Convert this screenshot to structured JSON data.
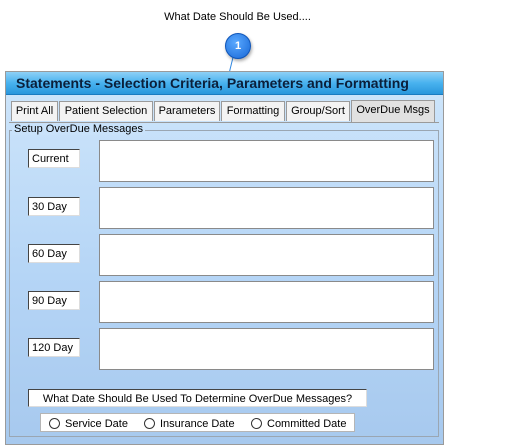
{
  "caption": "What Date Should Be Used....",
  "callout_number": "1",
  "window": {
    "title": "Statements - Selection Criteria, Parameters and Formatting"
  },
  "tabs": [
    {
      "label": "Print All"
    },
    {
      "label": "Patient Selection"
    },
    {
      "label": "Parameters"
    },
    {
      "label": "Formatting"
    },
    {
      "label": "Group/Sort"
    },
    {
      "label": "OverDue Msgs",
      "active": true
    }
  ],
  "group": {
    "label": "Setup OverDue Messages"
  },
  "messages": [
    {
      "label": "Current",
      "value": ""
    },
    {
      "label": "30 Day",
      "value": ""
    },
    {
      "label": "60 Day",
      "value": ""
    },
    {
      "label": "90 Day",
      "value": ""
    },
    {
      "label": "120 Day",
      "value": ""
    }
  ],
  "question": "What Date Should Be Used To Determine OverDue Messages?",
  "date_options": [
    {
      "label": "Service Date",
      "selected": false
    },
    {
      "label": "Insurance Date",
      "selected": false
    },
    {
      "label": "Committed Date",
      "selected": false
    }
  ],
  "colors": {
    "title_bar": "#48b2ef",
    "panel_background": "#b5d5f6",
    "callout": "#1767d6",
    "connector": "#2f86e0"
  }
}
